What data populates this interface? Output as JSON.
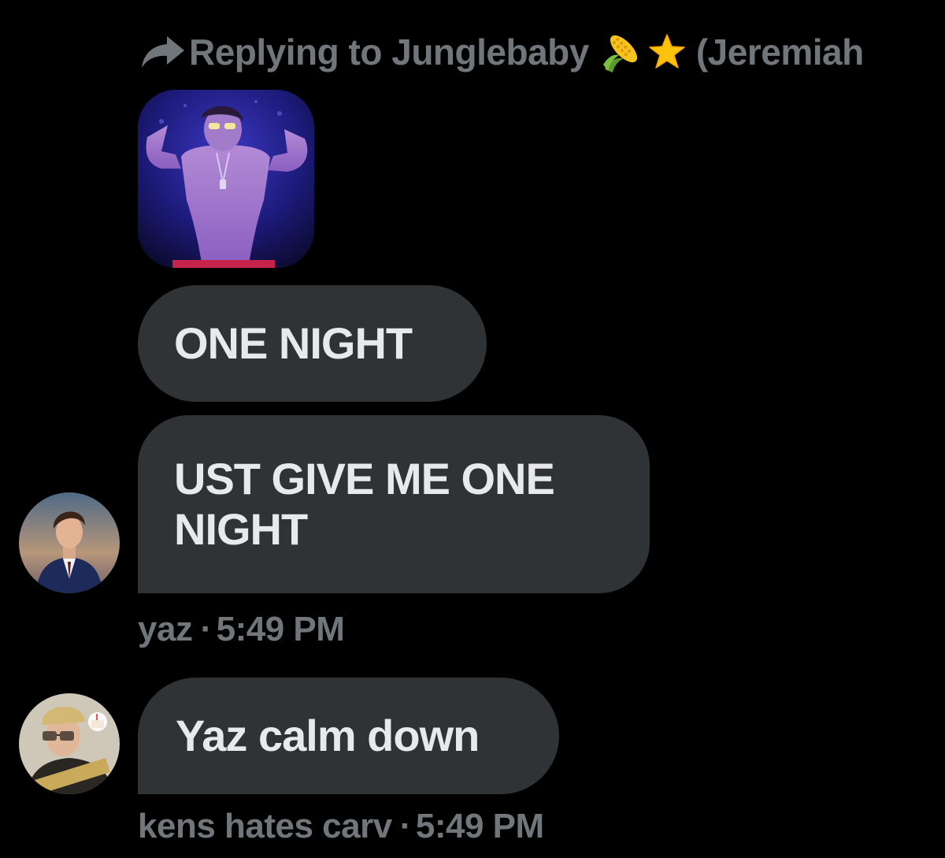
{
  "reply_header": {
    "prefix": "Replying to",
    "name": "Junglebaby",
    "emojis": [
      "corn-emoji",
      "star-emoji"
    ],
    "suffix": "(Jeremiah"
  },
  "messages": [
    {
      "id": 1,
      "type": "media",
      "description_icon": "shirtless-performer-photo"
    },
    {
      "id": 2,
      "type": "text",
      "text": "ONE NIGHT"
    },
    {
      "id": 3,
      "type": "text",
      "text": "UST GIVE ME ONE NIGHT"
    },
    {
      "id": 4,
      "type": "text",
      "text": "Yaz calm down"
    }
  ],
  "meta": [
    {
      "sender": "yaz",
      "separator": "·",
      "time": "5:49 PM"
    },
    {
      "sender": "kens hates carv",
      "separator": "·",
      "time": "5:49 PM"
    }
  ],
  "colors": {
    "background": "#000000",
    "bubble": "#2f3336",
    "text": "#e7e9ea",
    "secondary": "#71767b"
  }
}
